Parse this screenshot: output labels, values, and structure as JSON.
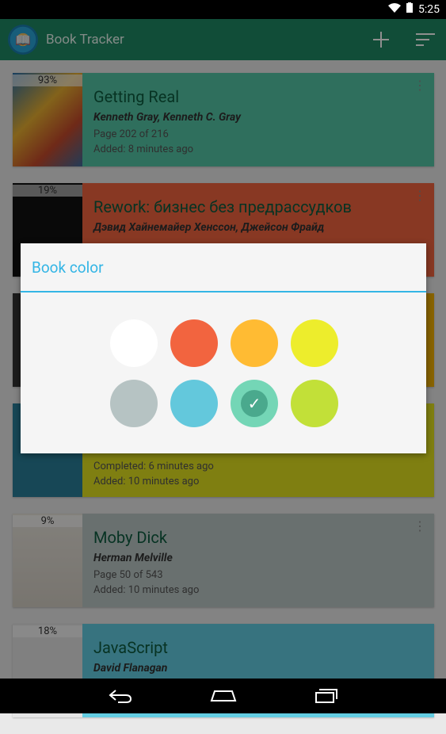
{
  "status": {
    "time": "5:25"
  },
  "app": {
    "title": "Book Tracker"
  },
  "books": [
    {
      "title": "Getting Real",
      "author": "Kenneth Gray, Kenneth C. Gray",
      "line1": "Page 202 of 216",
      "line2": "Added: 8 minutes ago",
      "percent": "93%",
      "color": "#55c7a6"
    },
    {
      "title": "Rework: бизнес без предрассудков",
      "author": "Дэвид Хайнемайер Хенссон, Джейсон Фрайд",
      "line1": "",
      "line2": "",
      "percent": "19%",
      "color": "#f2643f"
    },
    {
      "title": "",
      "author": "",
      "line1": "",
      "line2": "",
      "percent": "",
      "color": "#f3b000"
    },
    {
      "title": "",
      "author": "",
      "line1": "Completed: 6 minutes ago",
      "line2": "Added: 10 minutes ago",
      "percent": "",
      "color": "#e2e21f"
    },
    {
      "title": "Moby Dick",
      "author": "Herman Melville",
      "line1": "Page 50 of 543",
      "line2": "Added: 10 minutes ago",
      "percent": "9%",
      "color": "#bcc8c7"
    },
    {
      "title": "JavaScript",
      "author": "David Flanagan",
      "line1": "",
      "line2": "",
      "percent": "18%",
      "color": "#63cde2"
    }
  ],
  "dialog": {
    "title": "Book color",
    "swatches": [
      {
        "name": "white",
        "hex": "#ffffff"
      },
      {
        "name": "red",
        "hex": "#f2643f"
      },
      {
        "name": "orange",
        "hex": "#ffbb33"
      },
      {
        "name": "yellow",
        "hex": "#eded2c"
      },
      {
        "name": "gray",
        "hex": "#b6c3c3"
      },
      {
        "name": "blue",
        "hex": "#63c8dc"
      },
      {
        "name": "green-selected",
        "hex": "#74d6b6",
        "selected": true
      },
      {
        "name": "lime",
        "hex": "#c2e038"
      }
    ]
  }
}
